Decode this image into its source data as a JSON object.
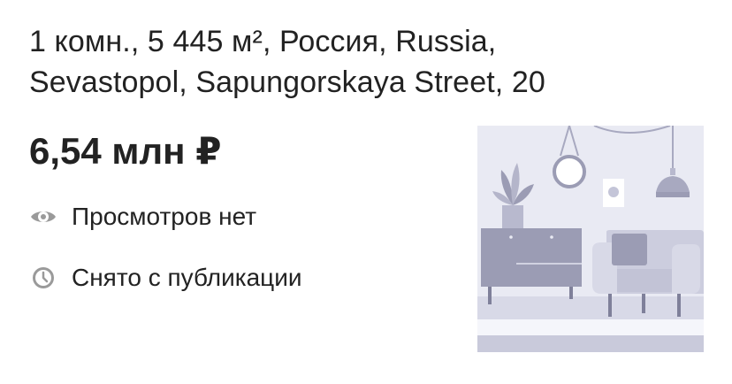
{
  "listing": {
    "title_line1": "1 комн., 5 445 м², Россия, Russia,",
    "title_line2": "Sevastopol, Sapungorskaya Street, 20",
    "price": "6,54 млн ₽",
    "views_text": "Просмотров нет",
    "status_text": "Снято с публикации",
    "views_icon": "eye-icon",
    "status_icon": "clock-icon"
  },
  "colors": {
    "text": "#222222",
    "icon": "#9a9a9a",
    "placeholder_bg": "#e9eaf3",
    "placeholder_dark": "#9b9cb4"
  }
}
